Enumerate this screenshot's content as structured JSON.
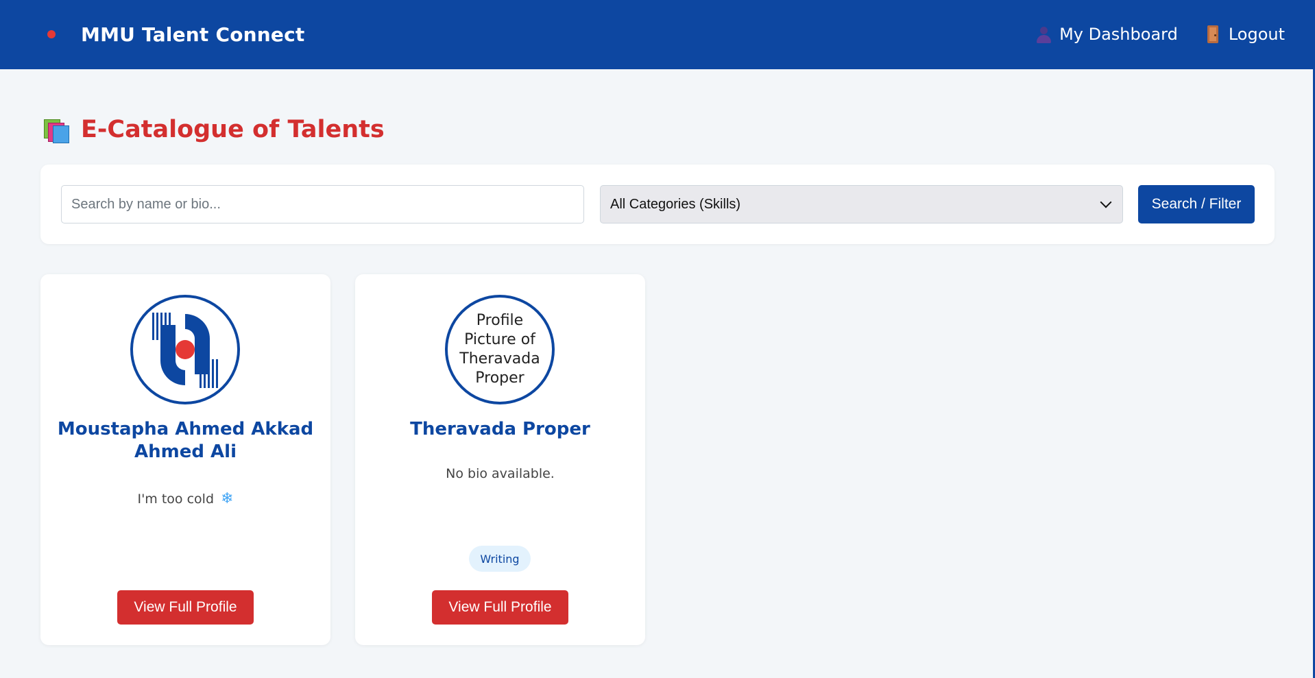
{
  "header": {
    "brand_title": "MMU Talent Connect",
    "nav": {
      "dashboard_label": "My Dashboard",
      "logout_label": "Logout"
    }
  },
  "page": {
    "title": "E-Catalogue of Talents",
    "title_icon": "books-icon"
  },
  "filters": {
    "search_placeholder": "Search by name or bio...",
    "search_value": "",
    "category_selected": "All Categories (Skills)",
    "submit_label": "Search / Filter"
  },
  "talents": [
    {
      "name": "Moustapha Ahmed Akkad Ahmed Ali",
      "bio": "I'm too cold",
      "bio_emoji": "❄",
      "avatar": "mmu-logo-image",
      "skills": [],
      "button_label": "View Full Profile"
    },
    {
      "name": "Theravada Proper",
      "bio": "No bio available.",
      "avatar_alt": "Profile Picture of Theravada Proper",
      "skills": [
        "Writing"
      ],
      "button_label": "View Full Profile"
    }
  ],
  "colors": {
    "primary_blue": "#0d47a1",
    "accent_red": "#d32f2f",
    "page_bg": "#f3f6f9",
    "badge_bg": "#e3f2fd"
  }
}
